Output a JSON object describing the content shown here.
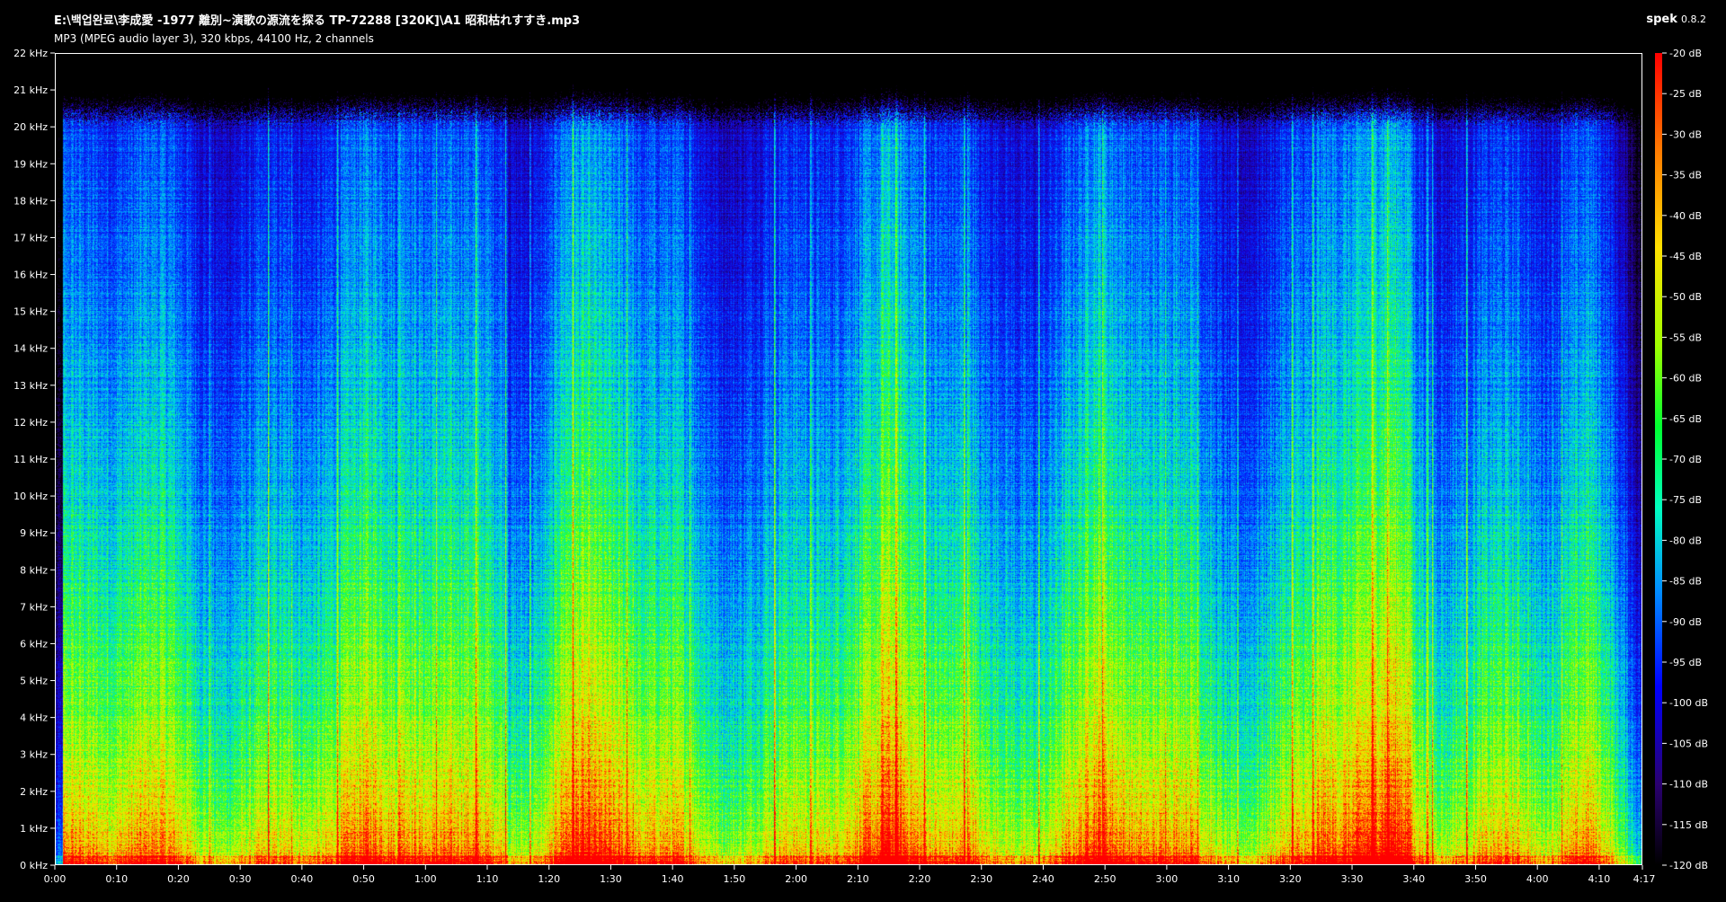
{
  "header": {
    "file_path": "E:\\백업완료\\李成愛 -1977 離別~演歌の源流を探る  TP-72288 [320K]\\A1 昭和枯れすすき.mp3",
    "file_info": "MP3 (MPEG audio layer 3), 320 kbps, 44100 Hz, 2 channels",
    "app_name": "spek",
    "app_version": "0.8.2"
  },
  "chart_data": {
    "type": "heatmap",
    "title": "",
    "xlabel": "",
    "ylabel": "",
    "x_axis": {
      "unit": "time (m:ss)",
      "range_seconds": [
        0,
        257
      ],
      "ticks": [
        "0:00",
        "0:10",
        "0:20",
        "0:30",
        "0:40",
        "0:50",
        "1:00",
        "1:10",
        "1:20",
        "1:30",
        "1:40",
        "1:50",
        "2:00",
        "2:10",
        "2:20",
        "2:30",
        "2:40",
        "2:50",
        "3:00",
        "3:10",
        "3:20",
        "3:30",
        "3:40",
        "3:50",
        "4:00",
        "4:10"
      ],
      "tick_seconds": [
        0,
        10,
        20,
        30,
        40,
        50,
        60,
        70,
        80,
        90,
        100,
        110,
        120,
        130,
        140,
        150,
        160,
        170,
        180,
        190,
        200,
        210,
        220,
        230,
        240,
        250
      ],
      "end_label": "4:17"
    },
    "y_axis": {
      "unit": "kHz",
      "range": [
        0,
        22
      ],
      "ticks": [
        "0 kHz",
        "1 kHz",
        "2 kHz",
        "3 kHz",
        "4 kHz",
        "5 kHz",
        "6 kHz",
        "7 kHz",
        "8 kHz",
        "9 kHz",
        "10 kHz",
        "11 kHz",
        "12 kHz",
        "13 kHz",
        "14 kHz",
        "15 kHz",
        "16 kHz",
        "17 kHz",
        "18 kHz",
        "19 kHz",
        "20 kHz",
        "21 kHz",
        "22 kHz"
      ]
    },
    "color_scale": {
      "unit": "dB",
      "range": [
        -120,
        -20
      ],
      "ticks": [
        "-20 dB",
        "-25 dB",
        "-30 dB",
        "-35 dB",
        "-40 dB",
        "-45 dB",
        "-50 dB",
        "-55 dB",
        "-60 dB",
        "-65 dB",
        "-70 dB",
        "-75 dB",
        "-80 dB",
        "-85 dB",
        "-90 dB",
        "-95 dB",
        "-100 dB",
        "-105 dB",
        "-110 dB",
        "-115 dB",
        "-120 dB"
      ]
    },
    "spectral_cutoff_khz": 20.5,
    "colors": {
      "background": "#000000",
      "axis": "#ffffff"
    }
  }
}
